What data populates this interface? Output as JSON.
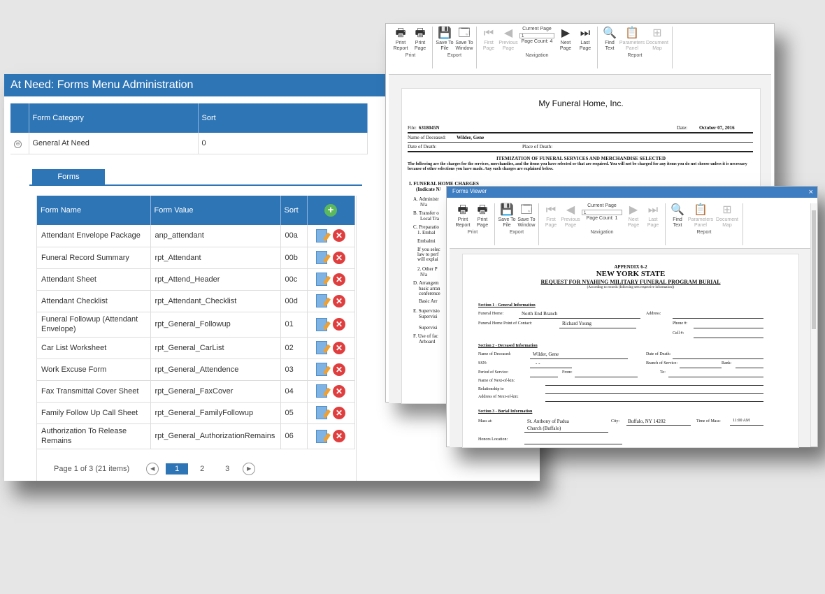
{
  "admin": {
    "title": "At Need: Forms Menu Administration",
    "category_headers": [
      "Form Category",
      "Sort"
    ],
    "category_rows": [
      {
        "name": "General At Need",
        "sort": "0"
      }
    ],
    "forms_tab": "Forms",
    "forms_headers": [
      "Form Name",
      "Form Value",
      "Sort"
    ],
    "forms_rows": [
      {
        "name": "Attendant Envelope Package",
        "value": "anp_attendant",
        "sort": "00a"
      },
      {
        "name": "Funeral Record Summary",
        "value": "rpt_Attendant",
        "sort": "00b"
      },
      {
        "name": "Attendant Sheet",
        "value": "rpt_Attend_Header",
        "sort": "00c"
      },
      {
        "name": "Attendant Checklist",
        "value": "rpt_Attendant_Checklist",
        "sort": "00d"
      },
      {
        "name": "Funeral Followup (Attendant Envelope)",
        "value": "rpt_General_Followup",
        "sort": "01"
      },
      {
        "name": "Car List Worksheet",
        "value": "rpt_General_CarList",
        "sort": "02"
      },
      {
        "name": "Work Excuse Form",
        "value": "rpt_General_Attendence",
        "sort": "03"
      },
      {
        "name": "Fax Transmittal Cover Sheet",
        "value": "rpt_General_FaxCover",
        "sort": "04"
      },
      {
        "name": "Family Follow Up Call Sheet",
        "value": "rpt_General_FamilyFollowup",
        "sort": "05"
      },
      {
        "name": "Authorization To Release Remains",
        "value": "rpt_General_AuthorizationRemains",
        "sort": "06"
      }
    ],
    "pager": {
      "summary": "Page 1 of 3 (21 items)",
      "pages": [
        "1",
        "2",
        "3"
      ],
      "current": "1"
    }
  },
  "viewer_back": {
    "ribbon": {
      "print": {
        "label": "Print",
        "buttons": [
          "Print Report",
          "Print Page"
        ]
      },
      "export": {
        "label": "Export",
        "buttons": [
          "Save To File",
          "Save To Window"
        ]
      },
      "navigation": {
        "label": "Navigation",
        "buttons": [
          "First Page",
          "Previous Page"
        ],
        "current_page_label": "Current Page",
        "current_page_value": "1",
        "page_count": "Page Count: 4",
        "buttons_after": [
          "Next Page",
          "Last Page"
        ]
      },
      "report": {
        "label": "Report",
        "buttons": [
          "Find Text",
          "Parameters Panel",
          "Document Map"
        ]
      }
    },
    "doc": {
      "company": "My Funeral Home, Inc.",
      "file_label": "File:",
      "file_value": "6318045N",
      "date_label": "Date:",
      "date_value": "October 07, 2016",
      "deceased_label": "Name of Deceased:",
      "deceased_value": "Wilder, Gene",
      "dod_label": "Date of Death:",
      "pod_label": "Place of Death:",
      "heading": "ITEMIZATION OF FUNERAL SERVICES AND MERCHANDISE SELECTED",
      "intro": "The following are the charges for the services, merchandise, and the items you have selected or that are required. You will not be charged for any items you do not choose unless it is necessary because of other selections you have made. Any such charges are explained below.",
      "section": "I. FUNERAL HOME CHARGES",
      "section_sub": "(Indicate N/",
      "items": [
        "A. Administr",
        "N/a",
        "B. Transfer o",
        "Local Tra",
        "C. Preparatio",
        "1. Embal",
        "Embalmi",
        "If you selec",
        "law to perf",
        "will explai",
        "2. Other P",
        "N/a",
        "D. Arrangem",
        "basic arran",
        "conference",
        "Basic Arr",
        "E. Supervisio",
        "Supervisi",
        "Supervisi",
        "F. Use of fac",
        "Arboard"
      ]
    }
  },
  "viewer_front": {
    "title": "Forms Viewer",
    "close": "×",
    "ribbon": {
      "print": {
        "label": "Print",
        "buttons": [
          "Print Report",
          "Print Page"
        ]
      },
      "export": {
        "label": "Export",
        "buttons": [
          "Save To File",
          "Save To Window"
        ]
      },
      "navigation": {
        "label": "Navigation",
        "buttons": [
          "First Page",
          "Previous Page"
        ],
        "current_page_label": "Current Page",
        "current_page_value": "1",
        "page_count": "Page Count: 1",
        "buttons_after": [
          "Next Page",
          "Last Page"
        ]
      },
      "report": {
        "label": "Report",
        "buttons": [
          "Find Text",
          "Parameters Panel",
          "Document Map"
        ]
      }
    },
    "doc": {
      "appendix": "APPENDIX 6-2",
      "state": "NEW YORK STATE",
      "request": "REQUEST FOR NYAHING MILITARY FUNERAL PROGRAM BURIAL",
      "sub": "(According to records (following sets respective information))",
      "s1": "Section 1 - General Information",
      "funeral_home_label": "Funeral Home:",
      "funeral_home_value": "North End Branch",
      "address_label": "Address:",
      "poc_label": "Funeral Home Point of Contact:",
      "poc_value": "Richard Young",
      "phone_label": "Phone #:",
      "cell_label": "Cell #:",
      "s2": "Section 2 - Deceased Information",
      "nod_label": "Name of Deceased:",
      "nod_value": "Wilder, Gene",
      "dod_label": "Date of Death:",
      "ssn_label": "SSN:",
      "ssn_value": "- -",
      "branch_label": "Branch of Service:",
      "rank_label": "Rank:",
      "period_label": "Period of Service:",
      "from_label": "From:",
      "to_label": "To:",
      "nok_label": "Name of Next-of-kin:",
      "rel_label": "Relationship to",
      "addr_nok_label": "Address of Next-of-kin:",
      "s3": "Section 3 - Burial Information",
      "mass_label": "Mass at:",
      "mass_value1": "St. Anthony of Padua",
      "mass_value2": "Church (Buffalo)",
      "city_label": "City:",
      "city_value": "Buffalo, NY 14202",
      "time_label": "Time of Mass:",
      "time_value": "11:00 AM",
      "honors_label": "Honors Location:"
    }
  }
}
